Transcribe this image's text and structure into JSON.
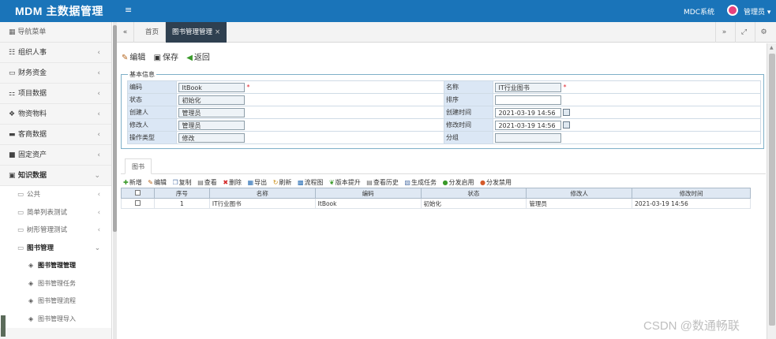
{
  "header": {
    "app_title": "MDM 主数据管理",
    "menu_icon": "hamburger-icon",
    "system_name": "MDC系统",
    "user_name": "管理员",
    "user_caret": "▾"
  },
  "sidebar": {
    "head_label": "导航菜单",
    "items": [
      {
        "label": "组织人事",
        "icon": "sitemap-icon"
      },
      {
        "label": "财务资金",
        "icon": "wallet-icon"
      },
      {
        "label": "项目数据",
        "icon": "org-chart-icon"
      },
      {
        "label": "物资物料",
        "icon": "cubes-icon"
      },
      {
        "label": "客商数据",
        "icon": "users-icon"
      },
      {
        "label": "固定资产",
        "icon": "building-icon"
      },
      {
        "label": "知识数据",
        "icon": "book-icon"
      }
    ],
    "sub_items": [
      {
        "label": "公共"
      },
      {
        "label": "简单列表测试"
      },
      {
        "label": "树形管理测试"
      },
      {
        "label": "图书管理"
      }
    ],
    "leaf_items": [
      {
        "label": "图书管理管理"
      },
      {
        "label": "图书管理任务"
      },
      {
        "label": "图书管理流程"
      },
      {
        "label": "图书管理导入"
      }
    ]
  },
  "tabs": {
    "home_label": "首页",
    "active_label": "图书管理管理",
    "close_glyph": "×"
  },
  "toolbar": {
    "edit_label": "编辑",
    "save_label": "保存",
    "back_label": "返回"
  },
  "form": {
    "legend": "基本信息",
    "fields": {
      "code_label": "编码",
      "code_value": "ItBook",
      "name_label": "名称",
      "name_value": "IT行业图书",
      "status_label": "状态",
      "status_value": "初始化",
      "sort_label": "排序",
      "sort_value": "",
      "creator_label": "创建人",
      "creator_value": "管理员",
      "created_label": "创建时间",
      "created_value": "2021-03-19 14:56",
      "modifier_label": "修改人",
      "modifier_value": "管理员",
      "modified_label": "修改时间",
      "modified_value": "2021-03-19 14:56",
      "optype_label": "操作类型",
      "optype_value": "修改",
      "group_label": "分组",
      "group_value": ""
    },
    "required_mark": "*"
  },
  "grid_tab": {
    "label": "图书"
  },
  "grid_toolbar": [
    {
      "label": "新增",
      "icon": "add-icon"
    },
    {
      "label": "编辑",
      "icon": "edit-icon"
    },
    {
      "label": "复制",
      "icon": "copy-icon"
    },
    {
      "label": "查看",
      "icon": "view-icon"
    },
    {
      "label": "删除",
      "icon": "delete-icon"
    },
    {
      "label": "导出",
      "icon": "export-icon"
    },
    {
      "label": "刷新",
      "icon": "refresh-icon"
    },
    {
      "label": "流程图",
      "icon": "flowchart-icon"
    },
    {
      "label": "版本提升",
      "icon": "upgrade-icon"
    },
    {
      "label": "查看历史",
      "icon": "history-icon"
    },
    {
      "label": "生成任务",
      "icon": "task-icon"
    },
    {
      "label": "分发启用",
      "icon": "enable-icon"
    },
    {
      "label": "分发禁用",
      "icon": "disable-icon"
    }
  ],
  "grid": {
    "columns": [
      "",
      "序号",
      "名称",
      "编码",
      "状态",
      "修改人",
      "修改时间"
    ],
    "rows": [
      [
        "",
        "1",
        "IT行业图书",
        "ItBook",
        "初始化",
        "管理员",
        "2021-03-19 14:56"
      ]
    ]
  },
  "watermark": "CSDN @数通畅联",
  "colors": {
    "topbar": "#1a74b9",
    "active_tab": "#2f4050",
    "label_bg": "#dbe7f5",
    "required": "#e0242c"
  }
}
